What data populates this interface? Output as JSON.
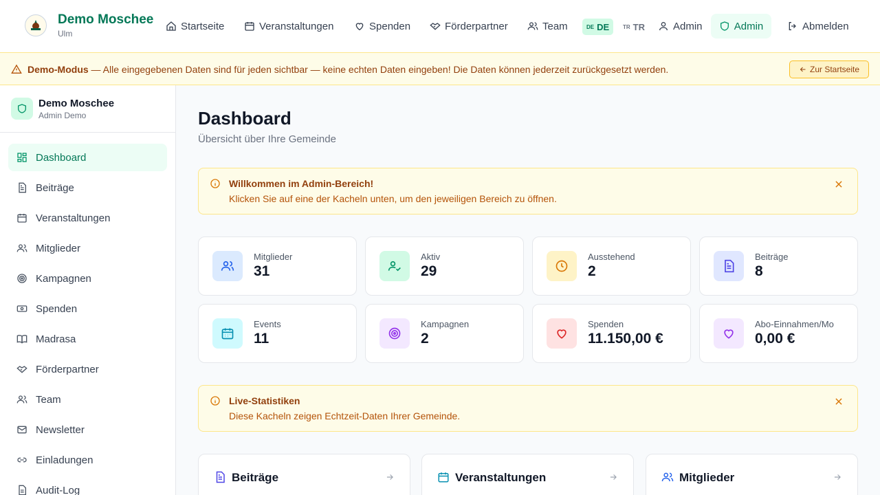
{
  "brand": {
    "title": "Demo Moschee",
    "city": "Ulm"
  },
  "nav": [
    {
      "label": "Startseite",
      "icon": "home-icon"
    },
    {
      "label": "Veranstaltungen",
      "icon": "calendar-icon"
    },
    {
      "label": "Spenden",
      "icon": "heart-icon"
    },
    {
      "label": "Förderpartner",
      "icon": "handshake-icon"
    },
    {
      "label": "Team",
      "icon": "users-icon"
    },
    {
      "label": "Admin",
      "icon": "user-icon"
    },
    {
      "label": "Admin",
      "icon": "shield-icon"
    },
    {
      "label": "Abmelden",
      "icon": "logout-icon"
    }
  ],
  "lang": {
    "de_flag": "DE",
    "de": "DE",
    "tr_flag": "TR",
    "tr": "TR"
  },
  "banner": {
    "strong": "Demo-Modus",
    "text": " — Alle eingegebenen Daten sind für jeden sichtbar — keine echten Daten eingeben! Die Daten können jederzeit zurückgesetzt werden.",
    "button": "Zur Startseite"
  },
  "sidebar": {
    "title": "Demo Moschee",
    "subtitle": "Admin Demo",
    "items": [
      {
        "label": "Dashboard",
        "icon": "dashboard-icon"
      },
      {
        "label": "Beiträge",
        "icon": "document-icon"
      },
      {
        "label": "Veranstaltungen",
        "icon": "calendar-icon"
      },
      {
        "label": "Mitglieder",
        "icon": "users-icon"
      },
      {
        "label": "Kampagnen",
        "icon": "target-icon"
      },
      {
        "label": "Spenden",
        "icon": "banknote-icon"
      },
      {
        "label": "Madrasa",
        "icon": "book-icon"
      },
      {
        "label": "Förderpartner",
        "icon": "handshake-icon"
      },
      {
        "label": "Team",
        "icon": "users-icon"
      },
      {
        "label": "Newsletter",
        "icon": "mail-icon"
      },
      {
        "label": "Einladungen",
        "icon": "link-icon"
      },
      {
        "label": "Audit-Log",
        "icon": "document-icon"
      }
    ]
  },
  "main": {
    "title": "Dashboard",
    "subtitle": "Übersicht über Ihre Gemeinde",
    "welcome": {
      "title": "Willkommen im Admin-Bereich!",
      "text": "Klicken Sie auf eine der Kacheln unten, um den jeweiligen Bereich zu öffnen."
    },
    "live": {
      "title": "Live-Statistiken",
      "text": "Diese Kacheln zeigen Echtzeit-Daten Ihrer Gemeinde."
    },
    "stats": [
      {
        "label": "Mitglieder",
        "value": "31",
        "icon": "users-icon",
        "bg": "#dbeafe",
        "color": "#2563eb"
      },
      {
        "label": "Aktiv",
        "value": "29",
        "icon": "user-check-icon",
        "bg": "#d1fae5",
        "color": "#059669"
      },
      {
        "label": "Ausstehend",
        "value": "2",
        "icon": "clock-icon",
        "bg": "#fef3c7",
        "color": "#d97706"
      },
      {
        "label": "Beiträge",
        "value": "8",
        "icon": "document-icon",
        "bg": "#e0e7ff",
        "color": "#4f46e5"
      },
      {
        "label": "Events",
        "value": "11",
        "icon": "calendar-icon",
        "bg": "#cffafe",
        "color": "#0891b2"
      },
      {
        "label": "Kampagnen",
        "value": "2",
        "icon": "target-icon",
        "bg": "#f3e8ff",
        "color": "#9333ea"
      },
      {
        "label": "Spenden",
        "value": "11.150,00 €",
        "icon": "heart-icon",
        "bg": "#fee2e2",
        "color": "#dc2626"
      },
      {
        "label": "Abo-Einnahmen/Mo",
        "value": "0,00 €",
        "icon": "heart-icon",
        "bg": "#f3e8ff",
        "color": "#9333ea"
      }
    ],
    "modules": [
      {
        "label": "Beiträge",
        "icon": "document-icon",
        "color": "#4f46e5"
      },
      {
        "label": "Veranstaltungen",
        "icon": "calendar-icon",
        "color": "#0891b2"
      },
      {
        "label": "Mitglieder",
        "icon": "users-icon",
        "color": "#2563eb"
      }
    ]
  }
}
